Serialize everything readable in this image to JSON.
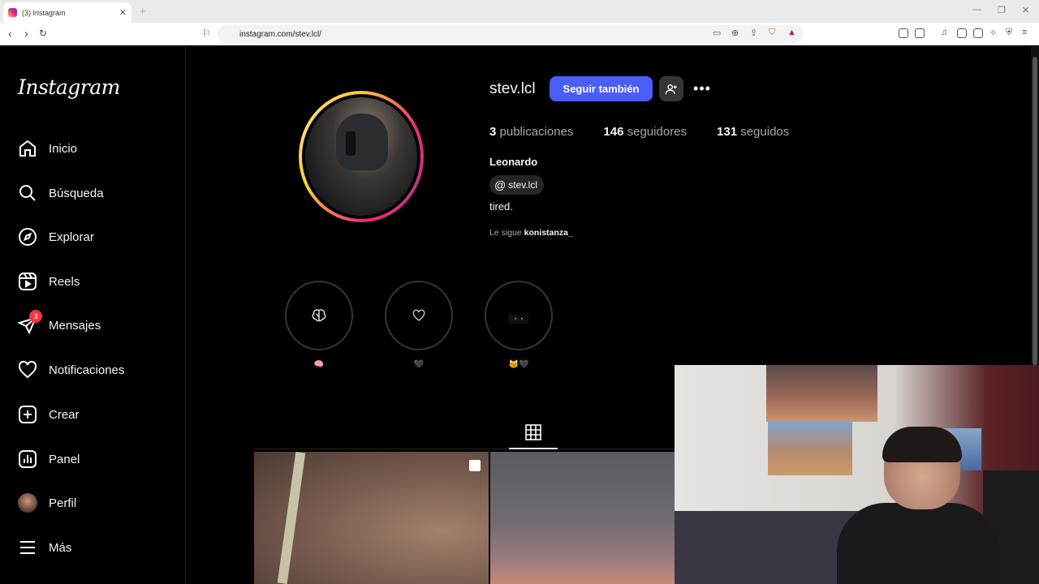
{
  "browser": {
    "tab_title": "(3) Instagram",
    "tab_close": "✕",
    "new_tab": "+",
    "url": "instagram.com/stev.lcl/",
    "window_controls": [
      "—",
      "❐",
      "✕"
    ]
  },
  "sidebar": {
    "logo": "Instagram",
    "items": [
      {
        "label": "Inicio",
        "icon": "home-icon"
      },
      {
        "label": "Búsqueda",
        "icon": "search-icon"
      },
      {
        "label": "Explorar",
        "icon": "compass-icon"
      },
      {
        "label": "Reels",
        "icon": "reels-icon"
      },
      {
        "label": "Mensajes",
        "icon": "messages-icon",
        "badge": "3"
      },
      {
        "label": "Notificaciones",
        "icon": "heart-icon"
      },
      {
        "label": "Crear",
        "icon": "plus-square-icon"
      },
      {
        "label": "Panel",
        "icon": "chart-icon"
      },
      {
        "label": "Perfil",
        "icon": "avatar"
      },
      {
        "label": "Más",
        "icon": "menu-icon"
      }
    ]
  },
  "profile": {
    "username": "stev.lcl",
    "follow_label": "Seguir también",
    "more_label": "•••",
    "stats": {
      "posts_count": "3",
      "posts_label": "publicaciones",
      "followers_count": "146",
      "followers_label": "seguidores",
      "following_count": "131",
      "following_label": "seguidos"
    },
    "full_name": "Leonardo",
    "threads_handle": "stev.lcl",
    "bio": "tired.",
    "followed_by_prefix": "Le sigue",
    "followed_by_user": "konistanza_"
  },
  "highlights": [
    {
      "label": "🧠",
      "icon": "brain-icon"
    },
    {
      "label": "🖤",
      "icon": "heart-outline-icon"
    },
    {
      "label": "😼🖤",
      "icon": "cat-icon"
    }
  ],
  "colors": {
    "follow_button": "#4a5df9",
    "badge": "#ff3040",
    "background": "#000000"
  }
}
